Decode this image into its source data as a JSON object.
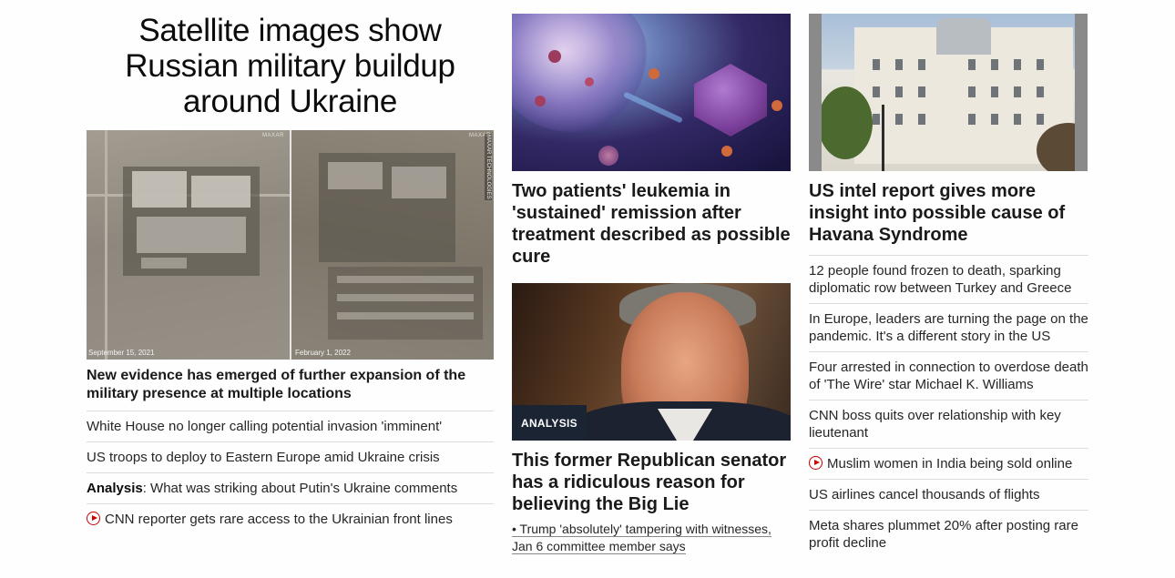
{
  "lead": {
    "title": "Satellite images show Russian military buildup around Ukraine",
    "image": {
      "date_left": "September 15, 2021",
      "date_right": "February 1, 2022",
      "watermark": "MAXAR",
      "credit": "MAXAR TECHNOLOGIES"
    },
    "subhead": "New evidence has emerged of further expansion of the military presence at multiple locations",
    "links": [
      {
        "text": "White House no longer calling potential invasion 'imminent'"
      },
      {
        "text": "US troops to deploy to Eastern Europe amid Ukraine crisis"
      },
      {
        "prefix": "Analysis",
        "text": ": What was striking about Putin's Ukraine comments"
      },
      {
        "icon": "play-icon",
        "text": "CNN reporter gets rare access to the Ukrainian front lines"
      }
    ]
  },
  "middle": {
    "story1": {
      "headline": "Two patients' leukemia in 'sustained' remission after treatment described as possible cure"
    },
    "story2": {
      "badge": "ANALYSIS",
      "headline": "This former Republican senator has a ridiculous reason for believing the Big Lie",
      "sublink": "• Trump 'absolutely' tampering with witnesses, Jan 6 committee member says"
    }
  },
  "right": {
    "headline": "US intel report gives more insight into possible cause of Havana Syndrome",
    "links": [
      {
        "text": "12 people found frozen to death, sparking diplomatic row between Turkey and Greece"
      },
      {
        "text": "In Europe, leaders are turning the page on the pandemic. It's a different story in the US"
      },
      {
        "text": "Four arrested in connection to overdose death of 'The Wire' star Michael K. Williams"
      },
      {
        "text": "CNN boss quits over relationship with key lieutenant"
      },
      {
        "icon": "play-icon",
        "text": "Muslim women in India being sold online"
      },
      {
        "text": "US airlines cancel thousands of flights"
      },
      {
        "text": "Meta shares plummet 20% after posting rare profit decline"
      }
    ]
  },
  "colors": {
    "accent_red": "#cc0000",
    "badge_bg": "#1a2433",
    "divider": "#dddddd"
  }
}
